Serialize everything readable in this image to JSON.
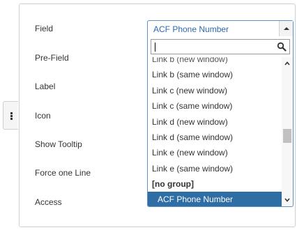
{
  "form": {
    "labels": {
      "field": "Field",
      "pre_field": "Pre-Field",
      "label": "Label",
      "icon": "Icon",
      "show_tooltip": "Show Tooltip",
      "force_one_line": "Force one Line",
      "access": "Access"
    }
  },
  "select": {
    "value": "ACF Phone Number",
    "search_value": "",
    "options": [
      {
        "label": "Link b (new window)",
        "type": "cut"
      },
      {
        "label": "Link b (same window)",
        "type": "option"
      },
      {
        "label": "Link c (new window)",
        "type": "option"
      },
      {
        "label": "Link c (same window)",
        "type": "option"
      },
      {
        "label": "Link d (new window)",
        "type": "option"
      },
      {
        "label": "Link d (same window)",
        "type": "option"
      },
      {
        "label": "Link e (new window)",
        "type": "option"
      },
      {
        "label": "Link e (same window)",
        "type": "option"
      },
      {
        "label": "[no group]",
        "type": "group"
      },
      {
        "label": "ACF Phone Number",
        "type": "selected"
      }
    ]
  },
  "colors": {
    "accent": "#2f6da5",
    "selected_text": "#2a6aad",
    "border_focus": "#5b8fc6"
  },
  "icons": {
    "side_tab": "vertical-dots-icon",
    "search": "search-icon",
    "dropdown_toggle": "caret-up-icon",
    "scroll_up": "chevron-up-icon",
    "scroll_down": "chevron-down-icon"
  }
}
